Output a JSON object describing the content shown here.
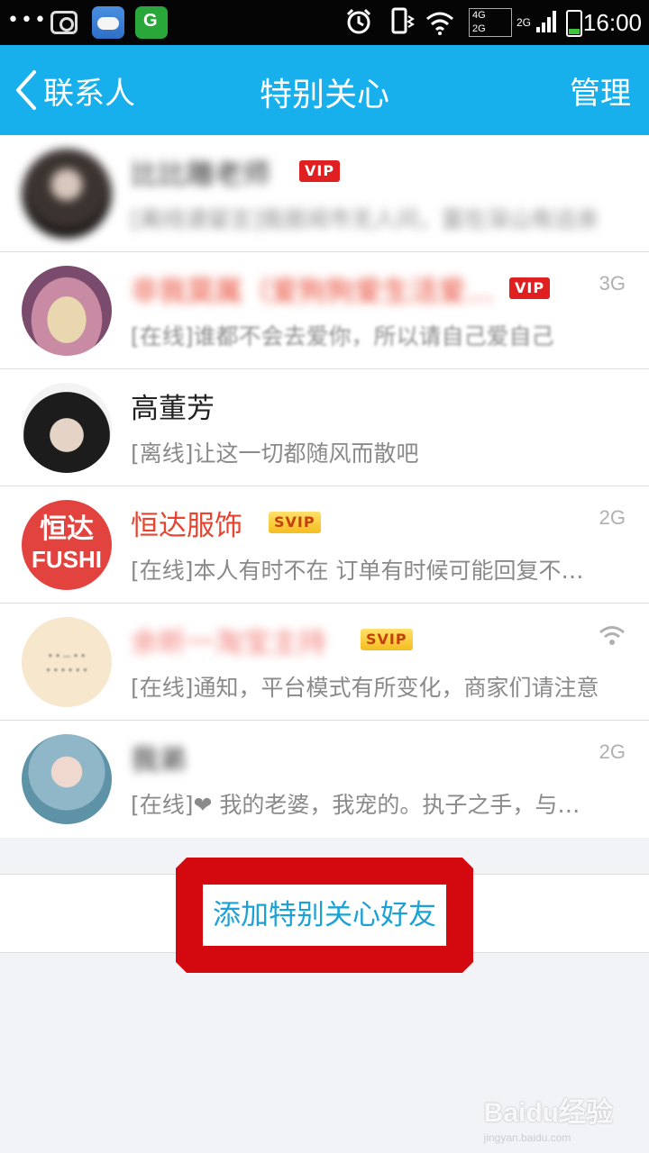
{
  "status_bar": {
    "time": "16:00",
    "network_top": "4G",
    "network_bottom": "2G",
    "network_secondary": "2G"
  },
  "navbar": {
    "back_label": "联系人",
    "title": "特别关心",
    "manage_label": "管理"
  },
  "contacts": [
    {
      "name": "比比雕老师",
      "badge": "VIP",
      "status": "[离线请留言]我居闹市无人问，富在深山有远亲",
      "network": "",
      "name_color": "red",
      "blurred": true
    },
    {
      "name": "非我莫属（爱狗狗爱生活爱家人）",
      "badge": "VIP",
      "status": "[在线]谁都不会去爱你，所以请自己爱自己",
      "network": "3G",
      "name_color": "red",
      "blurred": true
    },
    {
      "name": "高董芳",
      "badge": "",
      "status": "[离线]让这一切都随风而散吧",
      "network": "",
      "name_color": "dark",
      "blurred": false
    },
    {
      "name": "恒达服饰",
      "badge": "SVIP",
      "status": "[在线]本人有时不在  订单有时候可能回复不及时",
      "network": "2G",
      "name_color": "red",
      "blurred": false
    },
    {
      "name": "余昕一淘宝主持",
      "badge": "SVIP",
      "status": "[在线]通知，平台模式有所变化，商家们请注意",
      "network": "wifi",
      "name_color": "red",
      "blurred": true
    },
    {
      "name": "我弟",
      "badge": "",
      "status": "[在线]❤  我的老婆，我宠的。执子之手，与子偕老",
      "network": "2G",
      "name_color": "dark",
      "blurred": true
    }
  ],
  "add_button_label": "添加特别关心好友",
  "watermark": {
    "brand": "Baidu经验",
    "url": "jingyan.baidu.com"
  },
  "colors": {
    "navbar": "#17b0ec",
    "highlight": "#d4090f",
    "accent_text": "#1aa1d6",
    "name_red": "#e8432f"
  }
}
